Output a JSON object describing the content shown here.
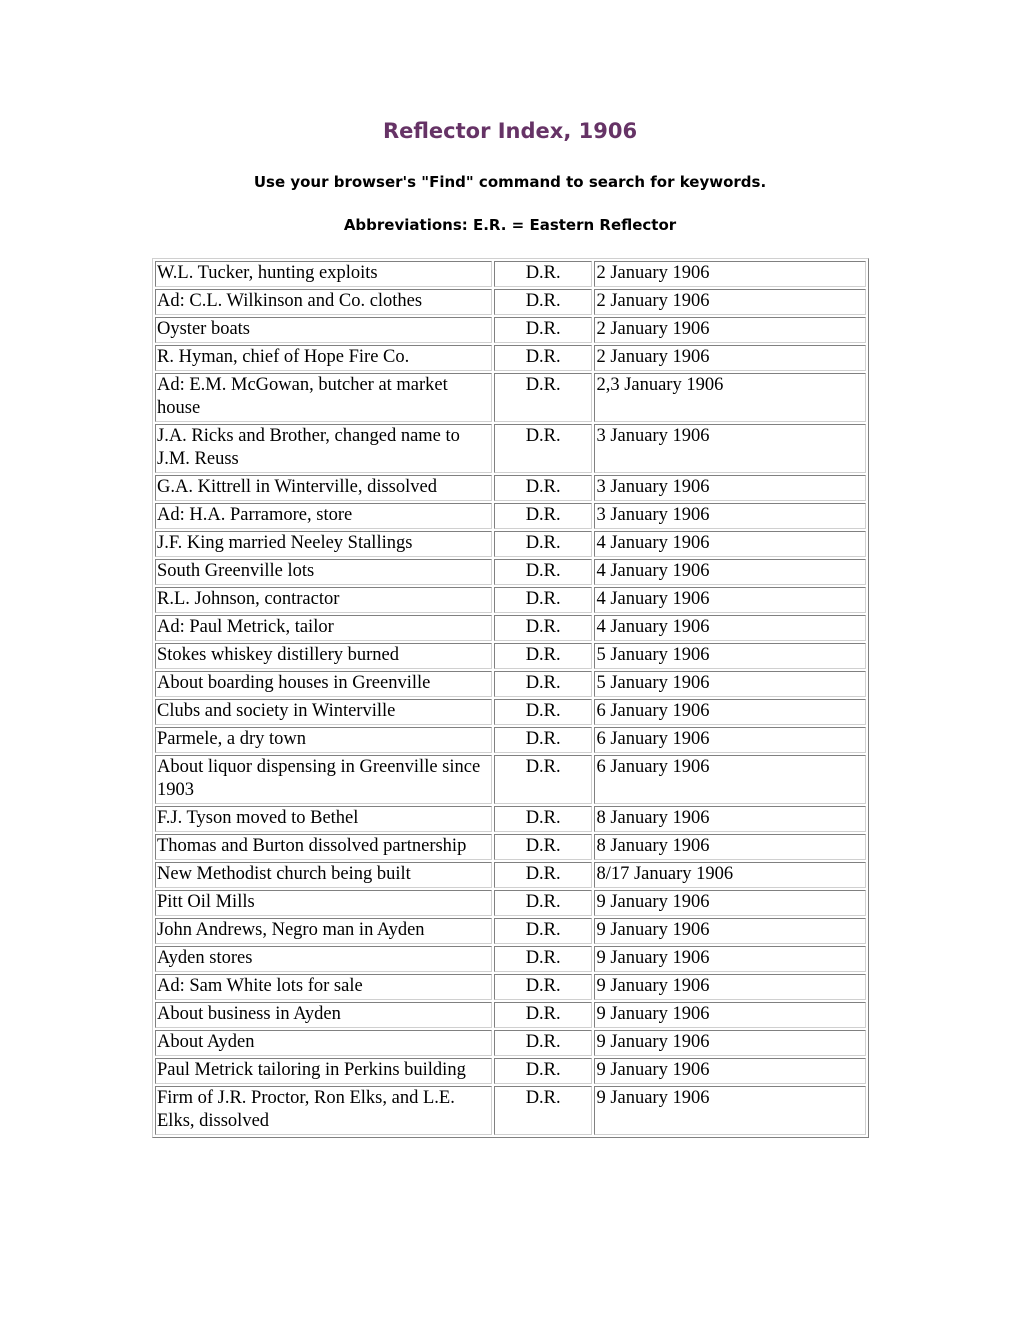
{
  "page": {
    "title": "Reflector Index, 1906",
    "instructions": "Use your browser's \"Find\" command to search for keywords.",
    "abbreviations": "Abbreviations: E.R. = Eastern Reflector",
    "title_color": "#663366"
  },
  "table": {
    "rows": [
      {
        "topic": "W.L. Tucker, hunting exploits",
        "source": "D.R.",
        "date": "2 January 1906"
      },
      {
        "topic": "Ad: C.L. Wilkinson and Co. clothes",
        "source": "D.R.",
        "date": "2 January 1906"
      },
      {
        "topic": "Oyster boats",
        "source": "D.R.",
        "date": "2 January 1906"
      },
      {
        "topic": "R. Hyman, chief of Hope Fire Co.",
        "source": "D.R.",
        "date": "2 January 1906"
      },
      {
        "topic": "Ad: E.M. McGowan, butcher at market house",
        "source": "D.R.",
        "date": "2,3 January 1906"
      },
      {
        "topic": "J.A. Ricks and Brother, changed name to J.M. Reuss",
        "source": "D.R.",
        "date": "3 January 1906"
      },
      {
        "topic": "G.A. Kittrell in Winterville, dissolved",
        "source": "D.R.",
        "date": "3 January 1906"
      },
      {
        "topic": "Ad: H.A. Parramore, store",
        "source": "D.R.",
        "date": "3 January 1906"
      },
      {
        "topic": "J.F. King married Neeley Stallings",
        "source": "D.R.",
        "date": "4 January 1906"
      },
      {
        "topic": "South Greenville lots",
        "source": "D.R.",
        "date": "4 January 1906"
      },
      {
        "topic": "R.L. Johnson, contractor",
        "source": "D.R.",
        "date": "4 January 1906"
      },
      {
        "topic": "Ad: Paul Metrick, tailor",
        "source": "D.R.",
        "date": "4 January 1906"
      },
      {
        "topic": "Stokes whiskey distillery burned",
        "source": "D.R.",
        "date": "5 January 1906"
      },
      {
        "topic": "About boarding houses in Greenville",
        "source": "D.R.",
        "date": "5 January 1906"
      },
      {
        "topic": "Clubs and society in Winterville",
        "source": "D.R.",
        "date": "6 January 1906"
      },
      {
        "topic": "Parmele, a dry town",
        "source": "D.R.",
        "date": "6 January 1906"
      },
      {
        "topic": "About liquor dispensing in Greenville since 1903",
        "source": "D.R.",
        "date": "6 January 1906"
      },
      {
        "topic": "F.J. Tyson moved to Bethel",
        "source": "D.R.",
        "date": "8 January 1906"
      },
      {
        "topic": "Thomas and Burton dissolved partnership",
        "source": "D.R.",
        "date": "8 January 1906"
      },
      {
        "topic": "New Methodist church being built",
        "source": "D.R.",
        "date": "8/17 January 1906"
      },
      {
        "topic": "Pitt Oil Mills",
        "source": "D.R.",
        "date": "9 January 1906"
      },
      {
        "topic": "John Andrews, Negro man in Ayden",
        "source": "D.R.",
        "date": "9 January 1906"
      },
      {
        "topic": "Ayden stores",
        "source": "D.R.",
        "date": "9 January 1906"
      },
      {
        "topic": "Ad: Sam White lots for sale",
        "source": "D.R.",
        "date": "9 January 1906"
      },
      {
        "topic": "About business in Ayden",
        "source": "D.R.",
        "date": "9 January 1906"
      },
      {
        "topic": "About Ayden",
        "source": "D.R.",
        "date": "9 January 1906"
      },
      {
        "topic": "Paul Metrick tailoring in Perkins building",
        "source": "D.R.",
        "date": "9 January 1906"
      },
      {
        "topic": "Firm of J.R. Proctor, Ron Elks, and L.E. Elks, dissolved",
        "source": "D.R.",
        "date": "9 January 1906"
      }
    ]
  }
}
